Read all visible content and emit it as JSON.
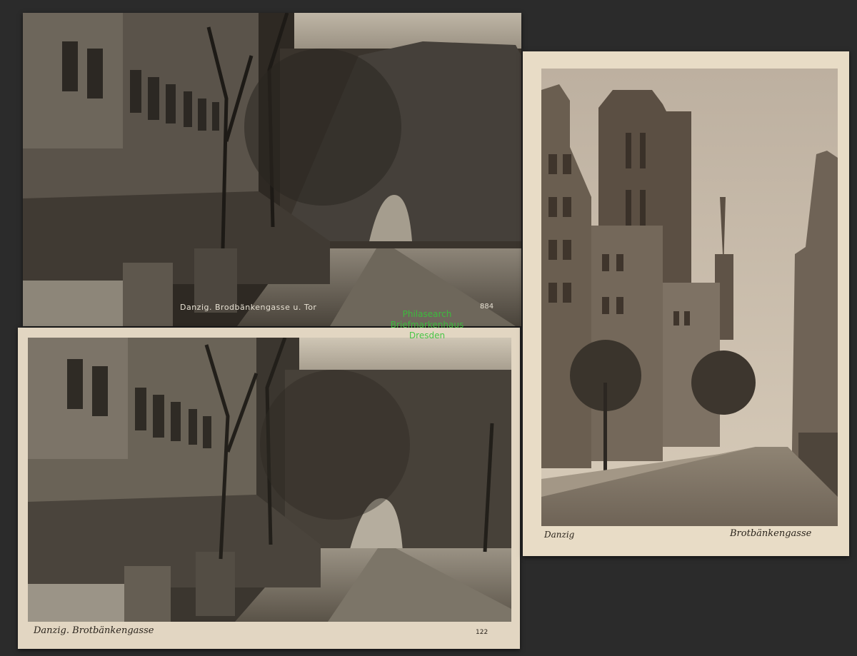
{
  "postcards": {
    "top": {
      "caption": "Danzig. Brodbänkengasse u. Tor",
      "number": "884"
    },
    "bottom": {
      "caption": "Danzig. Brotbänkengasse",
      "number": "122"
    },
    "right": {
      "caption_left": "Danzig",
      "caption_right": "Brotbänkengasse"
    }
  },
  "watermark": {
    "line1": "Philasearch",
    "line2": "Briefmarkenhaus",
    "line3": "Dresden"
  },
  "colors": {
    "background": "#2b2b2b",
    "sepia_dark": "#2a2520",
    "sepia_light": "#c9bfae",
    "card_paper": "#e2d6c2",
    "watermark": "#38c43a"
  }
}
